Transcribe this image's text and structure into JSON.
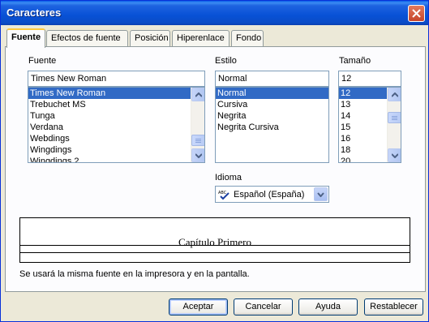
{
  "window": {
    "title": "Caracteres"
  },
  "tabs": [
    {
      "label": "Fuente",
      "active": true
    },
    {
      "label": "Efectos de fuente",
      "active": false
    },
    {
      "label": "Posición",
      "active": false
    },
    {
      "label": "Hiperenlace",
      "active": false
    },
    {
      "label": "Fondo",
      "active": false
    }
  ],
  "font": {
    "label": "Fuente",
    "value": "Times New Roman",
    "items": [
      "Times New Roman",
      "Trebuchet MS",
      "Tunga",
      "Verdana",
      "Webdings",
      "Wingdings",
      "Wingdings 2"
    ],
    "selected": "Times New Roman"
  },
  "style": {
    "label": "Estilo",
    "value": "Normal",
    "items": [
      "Normal",
      "Cursiva",
      "Negrita",
      "Negrita Cursiva"
    ],
    "selected": "Normal"
  },
  "size": {
    "label": "Tamaño",
    "value": "12",
    "items": [
      "12",
      "13",
      "14",
      "15",
      "16",
      "18",
      "20"
    ],
    "selected": "12"
  },
  "language": {
    "label": "Idioma",
    "value": "Español (España)",
    "icon": "spellcheck-icon"
  },
  "preview": {
    "text": "Capítulo Primero",
    "note": "Se usará la misma fuente en la impresora y en la pantalla."
  },
  "buttons": {
    "ok": "Aceptar",
    "cancel": "Cancelar",
    "help": "Ayuda",
    "reset": "Restablecer"
  },
  "colors": {
    "selection": "#316ac5",
    "title_bar": "#0851d6",
    "dialog_bg": "#ece9d8"
  }
}
